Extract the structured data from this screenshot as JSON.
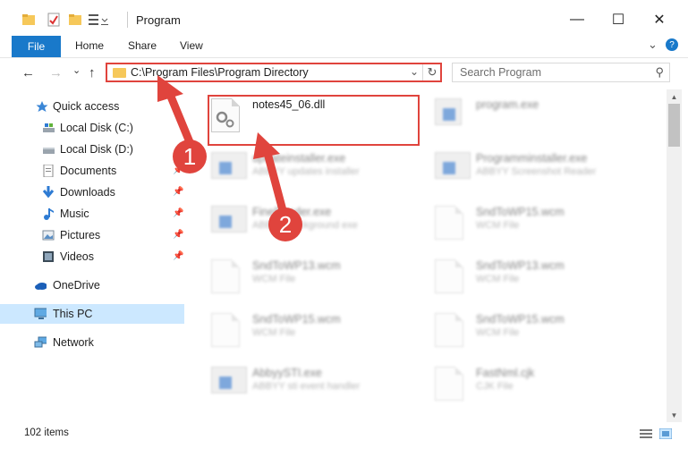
{
  "window": {
    "title": "Program",
    "minimize_glyph": "—",
    "maximize_glyph": "☐",
    "close_glyph": "✕"
  },
  "ribbon": {
    "tabs": [
      "File",
      "Home",
      "Share",
      "View"
    ],
    "collapse_glyph": "⌄",
    "help_glyph": "?"
  },
  "address": {
    "back_glyph": "←",
    "forward_glyph": "→",
    "recent_glyph": "⌄",
    "up_glyph": "↑",
    "path": "C:\\Program Files\\Program Directory",
    "refresh_glyph": "↻"
  },
  "search": {
    "placeholder": "Search Program"
  },
  "navigation": {
    "items": [
      {
        "label": "Quick access",
        "icon": "star-icon",
        "pinned": false
      },
      {
        "label": "Local Disk (C:)",
        "icon": "drive-icon",
        "pinned": false
      },
      {
        "label": "Local Disk (D:)",
        "icon": "drive-icon",
        "pinned": false
      },
      {
        "label": "Documents",
        "icon": "document-icon",
        "pinned": true
      },
      {
        "label": "Downloads",
        "icon": "download-icon",
        "pinned": true
      },
      {
        "label": "Music",
        "icon": "music-icon",
        "pinned": true
      },
      {
        "label": "Pictures",
        "icon": "picture-icon",
        "pinned": true
      },
      {
        "label": "Videos",
        "icon": "video-icon",
        "pinned": true
      },
      {
        "label": "OneDrive",
        "icon": "cloud-icon",
        "pinned": false
      },
      {
        "label": "This PC",
        "icon": "computer-icon",
        "pinned": false,
        "selected": true
      },
      {
        "label": "Network",
        "icon": "network-icon",
        "pinned": false
      }
    ]
  },
  "files": [
    {
      "name": "notes45_06.dll",
      "desc": "",
      "icon": "dll-gear-icon",
      "blurred": false
    },
    {
      "name": "program.exe",
      "desc": "",
      "icon": "program-icon",
      "blurred": true
    },
    {
      "name": "updateinstaller.exe",
      "desc": "ABBYY updates installer",
      "icon": "installer-icon",
      "blurred": true
    },
    {
      "name": "Programminstaller.exe",
      "desc": "ABBYY Screenshot Reader",
      "icon": "installer-icon",
      "blurred": true
    },
    {
      "name": "FineReader.exe",
      "desc": "ABBYY background exe",
      "icon": "installer-icon",
      "blurred": true
    },
    {
      "name": "SndToWP15.wcm",
      "desc": "WCM File",
      "icon": "file-icon",
      "blurred": true
    },
    {
      "name": "SndToWP13.wcm",
      "desc": "WCM File",
      "icon": "file-icon",
      "blurred": true
    },
    {
      "name": "SndToWP13.wcm",
      "desc": "WCM File",
      "icon": "file-icon",
      "blurred": true
    },
    {
      "name": "SndToWP15.wcm",
      "desc": "WCM File",
      "icon": "file-icon",
      "blurred": true
    },
    {
      "name": "SndToWP15.wcm",
      "desc": "WCM File",
      "icon": "file-icon",
      "blurred": true
    },
    {
      "name": "AbbyySTI.exe",
      "desc": "ABBYY sti event handler",
      "icon": "installer-icon",
      "blurred": true
    },
    {
      "name": "FastNml.cjk",
      "desc": "CJK File",
      "icon": "file-icon",
      "blurred": true
    }
  ],
  "status": {
    "item_count": "102 items"
  },
  "annotations": {
    "badge1": "1",
    "badge2": "2",
    "color": "#e0443d"
  },
  "colors": {
    "accent": "#1979ca",
    "selected": "#cce8ff",
    "annotation": "#e0443d"
  }
}
